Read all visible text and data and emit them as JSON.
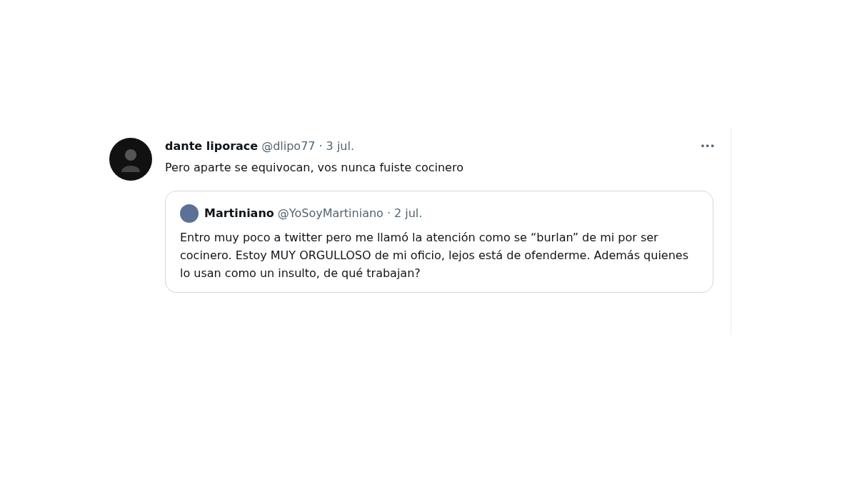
{
  "tweet": {
    "name": "dante liporace",
    "handle": "@dlipo77",
    "separator": "·",
    "date": "3 jul.",
    "more": "···",
    "text": "Pero aparte se equivocan, vos nunca fuiste cocinero",
    "quote": {
      "name": "Martiniano",
      "handle": "@YoSoyMartiniano",
      "separator": "·",
      "date": "2 jul.",
      "text": "Entro muy poco a twitter pero me llamó la atención como se “burlan” de mi por ser cocinero. Estoy MUY ORGULLOSO de mi oficio, lejos está de ofenderme. Además quienes lo usan como un insulto, de qué trabajan?"
    }
  }
}
